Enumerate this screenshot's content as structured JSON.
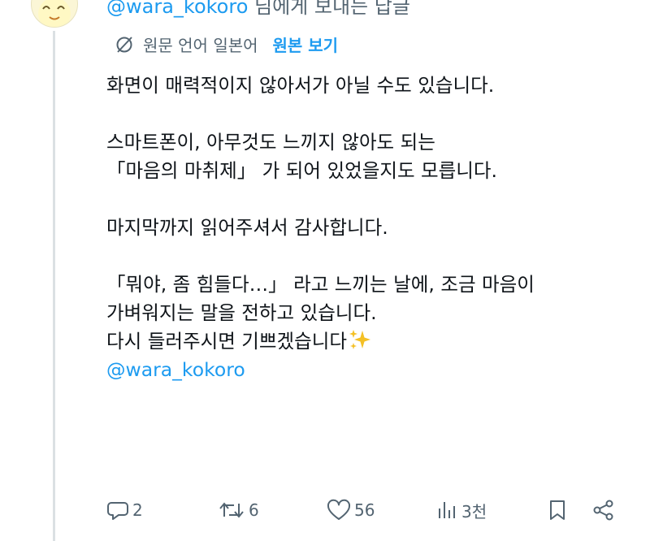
{
  "reply": {
    "prefix_mention": "@wara_kokoro",
    "suffix": " 님에게 보내는 답글"
  },
  "translation": {
    "label": "원문 언어 일본어",
    "link": "원본 보기"
  },
  "tweet": {
    "lines": [
      "화면이 매력적이지 않아서가 아닐 수도 있습니다.",
      "",
      "스마트폰이, 아무것도 느끼지 않아도 되는",
      "「마음의 마취제」 가 되어 있었을지도 모릅니다.",
      "",
      "마지막까지 읽어주셔서 감사합니다.",
      "",
      "「뭐야, 좀 힘들다…」 라고 느끼는 날에, 조금 마음이",
      "가벼워지는 말을 전하고 있습니다.",
      "다시 들러주시면 기쁘겠습니다"
    ],
    "mention": "@wara_kokoro"
  },
  "actions": {
    "replies": "2",
    "reposts": "6",
    "likes": "56",
    "views": "3천"
  },
  "colors": {
    "link": "#1d9bf0",
    "muted": "#536471",
    "text": "#0f1419",
    "sparkle": "#f4c025"
  },
  "icons": [
    "reply-icon",
    "repost-icon",
    "like-icon",
    "views-icon",
    "bookmark-icon",
    "share-icon",
    "translate-icon",
    "sparkles-icon"
  ]
}
